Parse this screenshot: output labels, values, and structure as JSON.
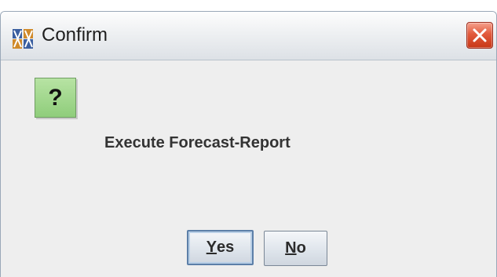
{
  "window": {
    "title": "Confirm",
    "app_icon": "jar-app-icon",
    "close_icon": "close-icon"
  },
  "dialog": {
    "icon": "question-icon",
    "icon_glyph": "?",
    "message": "Execute Forecast-Report"
  },
  "buttons": {
    "yes": {
      "mnemonic": "Y",
      "rest": "es"
    },
    "no": {
      "mnemonic": "N",
      "rest": "o"
    }
  },
  "colors": {
    "close_button": "#e25a3c",
    "question_icon_bg": "#8fcd7b",
    "dialog_bg": "#eeeeee"
  }
}
